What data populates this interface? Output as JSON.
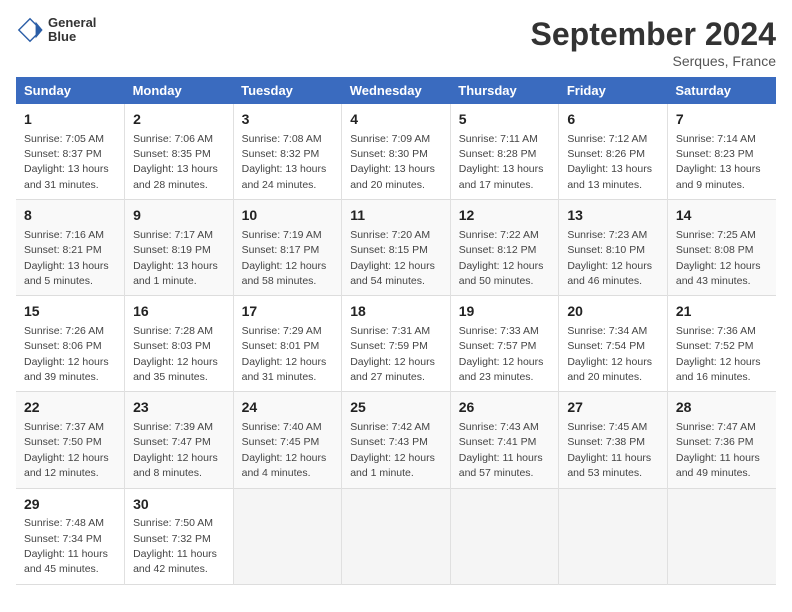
{
  "header": {
    "logo_line1": "General",
    "logo_line2": "Blue",
    "month": "September 2024",
    "location": "Serques, France"
  },
  "days_of_week": [
    "Sunday",
    "Monday",
    "Tuesday",
    "Wednesday",
    "Thursday",
    "Friday",
    "Saturday"
  ],
  "weeks": [
    [
      {
        "day": "1",
        "sunrise": "Sunrise: 7:05 AM",
        "sunset": "Sunset: 8:37 PM",
        "daylight": "Daylight: 13 hours and 31 minutes."
      },
      {
        "day": "2",
        "sunrise": "Sunrise: 7:06 AM",
        "sunset": "Sunset: 8:35 PM",
        "daylight": "Daylight: 13 hours and 28 minutes."
      },
      {
        "day": "3",
        "sunrise": "Sunrise: 7:08 AM",
        "sunset": "Sunset: 8:32 PM",
        "daylight": "Daylight: 13 hours and 24 minutes."
      },
      {
        "day": "4",
        "sunrise": "Sunrise: 7:09 AM",
        "sunset": "Sunset: 8:30 PM",
        "daylight": "Daylight: 13 hours and 20 minutes."
      },
      {
        "day": "5",
        "sunrise": "Sunrise: 7:11 AM",
        "sunset": "Sunset: 8:28 PM",
        "daylight": "Daylight: 13 hours and 17 minutes."
      },
      {
        "day": "6",
        "sunrise": "Sunrise: 7:12 AM",
        "sunset": "Sunset: 8:26 PM",
        "daylight": "Daylight: 13 hours and 13 minutes."
      },
      {
        "day": "7",
        "sunrise": "Sunrise: 7:14 AM",
        "sunset": "Sunset: 8:23 PM",
        "daylight": "Daylight: 13 hours and 9 minutes."
      }
    ],
    [
      {
        "day": "8",
        "sunrise": "Sunrise: 7:16 AM",
        "sunset": "Sunset: 8:21 PM",
        "daylight": "Daylight: 13 hours and 5 minutes."
      },
      {
        "day": "9",
        "sunrise": "Sunrise: 7:17 AM",
        "sunset": "Sunset: 8:19 PM",
        "daylight": "Daylight: 13 hours and 1 minute."
      },
      {
        "day": "10",
        "sunrise": "Sunrise: 7:19 AM",
        "sunset": "Sunset: 8:17 PM",
        "daylight": "Daylight: 12 hours and 58 minutes."
      },
      {
        "day": "11",
        "sunrise": "Sunrise: 7:20 AM",
        "sunset": "Sunset: 8:15 PM",
        "daylight": "Daylight: 12 hours and 54 minutes."
      },
      {
        "day": "12",
        "sunrise": "Sunrise: 7:22 AM",
        "sunset": "Sunset: 8:12 PM",
        "daylight": "Daylight: 12 hours and 50 minutes."
      },
      {
        "day": "13",
        "sunrise": "Sunrise: 7:23 AM",
        "sunset": "Sunset: 8:10 PM",
        "daylight": "Daylight: 12 hours and 46 minutes."
      },
      {
        "day": "14",
        "sunrise": "Sunrise: 7:25 AM",
        "sunset": "Sunset: 8:08 PM",
        "daylight": "Daylight: 12 hours and 43 minutes."
      }
    ],
    [
      {
        "day": "15",
        "sunrise": "Sunrise: 7:26 AM",
        "sunset": "Sunset: 8:06 PM",
        "daylight": "Daylight: 12 hours and 39 minutes."
      },
      {
        "day": "16",
        "sunrise": "Sunrise: 7:28 AM",
        "sunset": "Sunset: 8:03 PM",
        "daylight": "Daylight: 12 hours and 35 minutes."
      },
      {
        "day": "17",
        "sunrise": "Sunrise: 7:29 AM",
        "sunset": "Sunset: 8:01 PM",
        "daylight": "Daylight: 12 hours and 31 minutes."
      },
      {
        "day": "18",
        "sunrise": "Sunrise: 7:31 AM",
        "sunset": "Sunset: 7:59 PM",
        "daylight": "Daylight: 12 hours and 27 minutes."
      },
      {
        "day": "19",
        "sunrise": "Sunrise: 7:33 AM",
        "sunset": "Sunset: 7:57 PM",
        "daylight": "Daylight: 12 hours and 23 minutes."
      },
      {
        "day": "20",
        "sunrise": "Sunrise: 7:34 AM",
        "sunset": "Sunset: 7:54 PM",
        "daylight": "Daylight: 12 hours and 20 minutes."
      },
      {
        "day": "21",
        "sunrise": "Sunrise: 7:36 AM",
        "sunset": "Sunset: 7:52 PM",
        "daylight": "Daylight: 12 hours and 16 minutes."
      }
    ],
    [
      {
        "day": "22",
        "sunrise": "Sunrise: 7:37 AM",
        "sunset": "Sunset: 7:50 PM",
        "daylight": "Daylight: 12 hours and 12 minutes."
      },
      {
        "day": "23",
        "sunrise": "Sunrise: 7:39 AM",
        "sunset": "Sunset: 7:47 PM",
        "daylight": "Daylight: 12 hours and 8 minutes."
      },
      {
        "day": "24",
        "sunrise": "Sunrise: 7:40 AM",
        "sunset": "Sunset: 7:45 PM",
        "daylight": "Daylight: 12 hours and 4 minutes."
      },
      {
        "day": "25",
        "sunrise": "Sunrise: 7:42 AM",
        "sunset": "Sunset: 7:43 PM",
        "daylight": "Daylight: 12 hours and 1 minute."
      },
      {
        "day": "26",
        "sunrise": "Sunrise: 7:43 AM",
        "sunset": "Sunset: 7:41 PM",
        "daylight": "Daylight: 11 hours and 57 minutes."
      },
      {
        "day": "27",
        "sunrise": "Sunrise: 7:45 AM",
        "sunset": "Sunset: 7:38 PM",
        "daylight": "Daylight: 11 hours and 53 minutes."
      },
      {
        "day": "28",
        "sunrise": "Sunrise: 7:47 AM",
        "sunset": "Sunset: 7:36 PM",
        "daylight": "Daylight: 11 hours and 49 minutes."
      }
    ],
    [
      {
        "day": "29",
        "sunrise": "Sunrise: 7:48 AM",
        "sunset": "Sunset: 7:34 PM",
        "daylight": "Daylight: 11 hours and 45 minutes."
      },
      {
        "day": "30",
        "sunrise": "Sunrise: 7:50 AM",
        "sunset": "Sunset: 7:32 PM",
        "daylight": "Daylight: 11 hours and 42 minutes."
      },
      null,
      null,
      null,
      null,
      null
    ]
  ]
}
